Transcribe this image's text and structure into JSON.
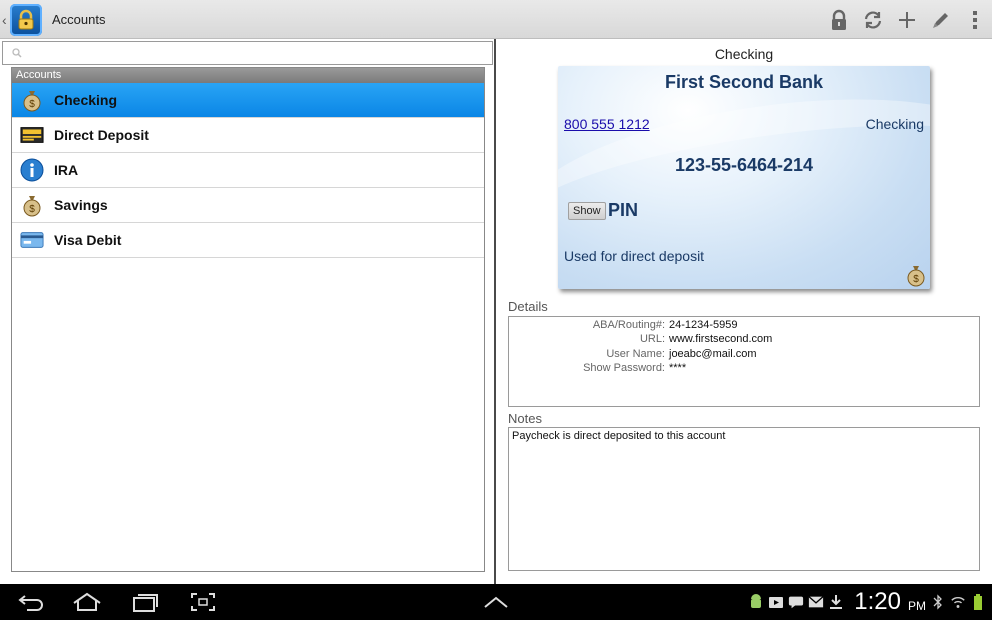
{
  "app": {
    "title": "Accounts",
    "icon": "lock-icon"
  },
  "toolbar": {
    "actions": [
      {
        "name": "lock-button",
        "icon": "padlock-icon"
      },
      {
        "name": "sync-button",
        "icon": "refresh-icon"
      },
      {
        "name": "add-button",
        "icon": "plus-icon"
      },
      {
        "name": "edit-button",
        "icon": "pencil-icon"
      },
      {
        "name": "overflow-menu-button",
        "icon": "more-vertical-icon"
      }
    ]
  },
  "search": {
    "value": "",
    "placeholder": ""
  },
  "accounts_list": {
    "header": "Accounts",
    "items": [
      {
        "label": "Checking",
        "icon": "money-bag-icon",
        "selected": true
      },
      {
        "label": "Direct Deposit",
        "icon": "check-card-icon",
        "selected": false
      },
      {
        "label": "IRA",
        "icon": "info-icon",
        "selected": false
      },
      {
        "label": "Savings",
        "icon": "money-bag-icon",
        "selected": false
      },
      {
        "label": "Visa Debit",
        "icon": "credit-card-icon",
        "selected": false
      }
    ]
  },
  "detail": {
    "title": "Checking",
    "card": {
      "bank_name": "First Second Bank",
      "phone": "800 555 1212",
      "account_type": "Checking",
      "account_number": "123-55-6464-214",
      "show_button": "Show",
      "pin_label": "PIN",
      "note": "Used for direct deposit",
      "icon": "money-bag-icon"
    },
    "details_label": "Details",
    "details": [
      {
        "key": "ABA/Routing#:",
        "value": "24-1234-5959"
      },
      {
        "key": "URL:",
        "value": "www.firstsecond.com"
      },
      {
        "key": "User Name:",
        "value": "joeabc@mail.com"
      },
      {
        "key": "Show Password:",
        "value": "****"
      }
    ],
    "notes_label": "Notes",
    "notes": "Paycheck is direct deposited to this account"
  },
  "system_bar": {
    "time": "1:20",
    "ampm": "PM",
    "nav": [
      "back-icon",
      "home-icon",
      "recent-apps-icon",
      "screenshot-icon",
      "chevron-up-icon"
    ],
    "status_icons": [
      "android-icon",
      "play-icon",
      "talk-icon",
      "gmail-icon",
      "download-icon",
      "bluetooth-icon",
      "wifi-icon",
      "battery-icon"
    ]
  },
  "colors": {
    "selection": "#0a86e6",
    "card_text": "#1a3a66",
    "link": "#1a0dab"
  }
}
